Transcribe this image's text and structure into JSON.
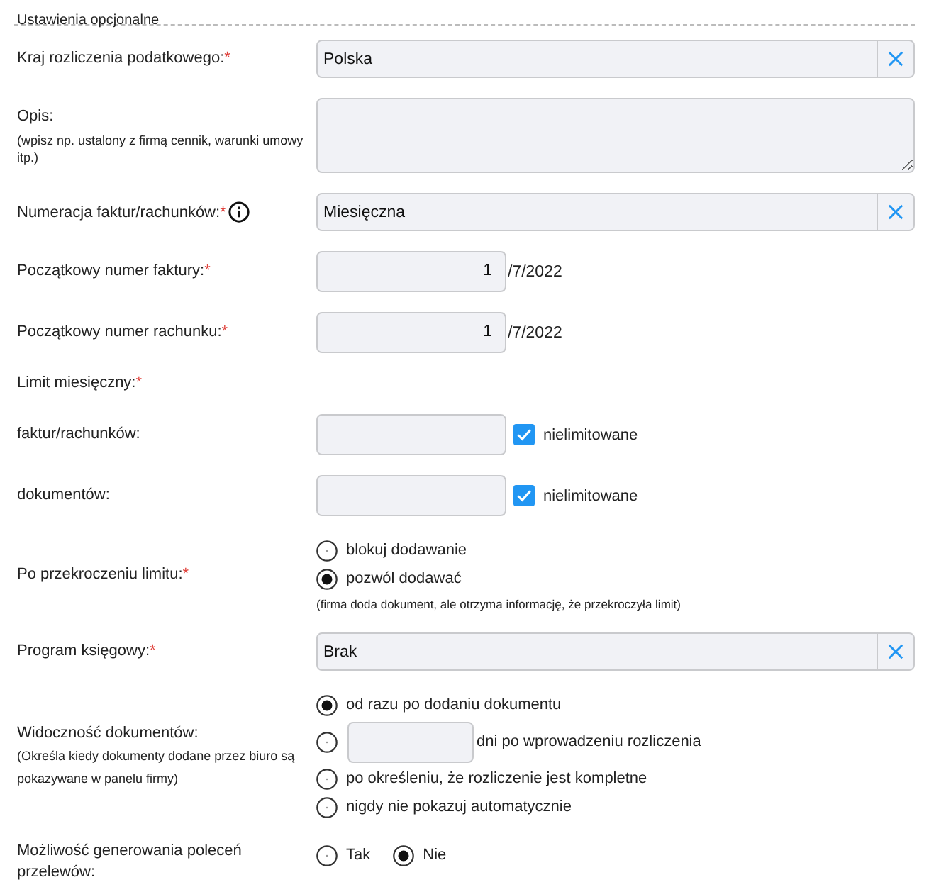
{
  "section": {
    "title": "Ustawienia opcjonalne"
  },
  "fields": [
    {
      "kind": "select",
      "label": "Kraj rozliczenia podatkowego:",
      "required_mark": "*",
      "value": "Polska"
    },
    {
      "kind": "textarea",
      "label": "Opis:",
      "hint": "(wpisz np. ustalony z firmą cennik, warunki umowy itp.)"
    },
    {
      "kind": "select",
      "label": "Numeracja faktur/rachunków:",
      "required_mark": "*",
      "info_icon": true,
      "value": "Miesięczna"
    },
    {
      "kind": "number",
      "label": "Początkowy numer faktury:",
      "required_mark": "*",
      "value": "1",
      "suffix": "/7/2022"
    },
    {
      "kind": "number",
      "label": "Początkowy numer rachunku:",
      "required_mark": "*",
      "value": "1",
      "suffix": "/7/2022"
    },
    {
      "kind": "heading",
      "label": "Limit miesięczny:",
      "required_mark": "*"
    },
    {
      "kind": "limit",
      "label": "faktur/rachunków:",
      "checkbox": {
        "label": "nielimitowane",
        "checked": true
      }
    },
    {
      "kind": "limit",
      "label": "dokumentów:",
      "checkbox": {
        "label": "nielimitowane",
        "checked": true
      }
    },
    {
      "kind": "radio",
      "label": "Po przekroczeniu limitu:",
      "required_mark": "*",
      "options": [
        {
          "kind": "plain",
          "label": "blokuj dodawanie",
          "selected": false
        },
        {
          "kind": "plain",
          "label": "pozwól dodawać",
          "selected": true
        }
      ],
      "note": "(firma doda dokument, ale otrzyma informację, że przekroczyła limit)"
    },
    {
      "kind": "select",
      "label": "Program księgowy:",
      "required_mark": "*",
      "value": "Brak"
    },
    {
      "kind": "radio",
      "label": "Widoczność dokumentów:",
      "hint": "(Określa kiedy dokumenty dodane przez biuro są pokazywane w panelu firmy)",
      "options": [
        {
          "kind": "plain",
          "label": "od razu po dodaniu dokumentu",
          "selected": true
        },
        {
          "kind": "days",
          "label": "dni po wprowadzeniu rozliczenia",
          "selected": false
        },
        {
          "kind": "plain",
          "label": "po określeniu, że rozliczenie jest kompletne",
          "selected": false
        },
        {
          "kind": "plain",
          "label": "nigdy nie pokazuj automatycznie",
          "selected": false
        }
      ]
    },
    {
      "kind": "radio_row",
      "label": "Możliwość generowania poleceń przelewów:",
      "options": [
        {
          "kind": "plain",
          "label": "Tak",
          "selected": false
        },
        {
          "kind": "plain",
          "label": "Nie",
          "selected": true
        }
      ]
    }
  ]
}
